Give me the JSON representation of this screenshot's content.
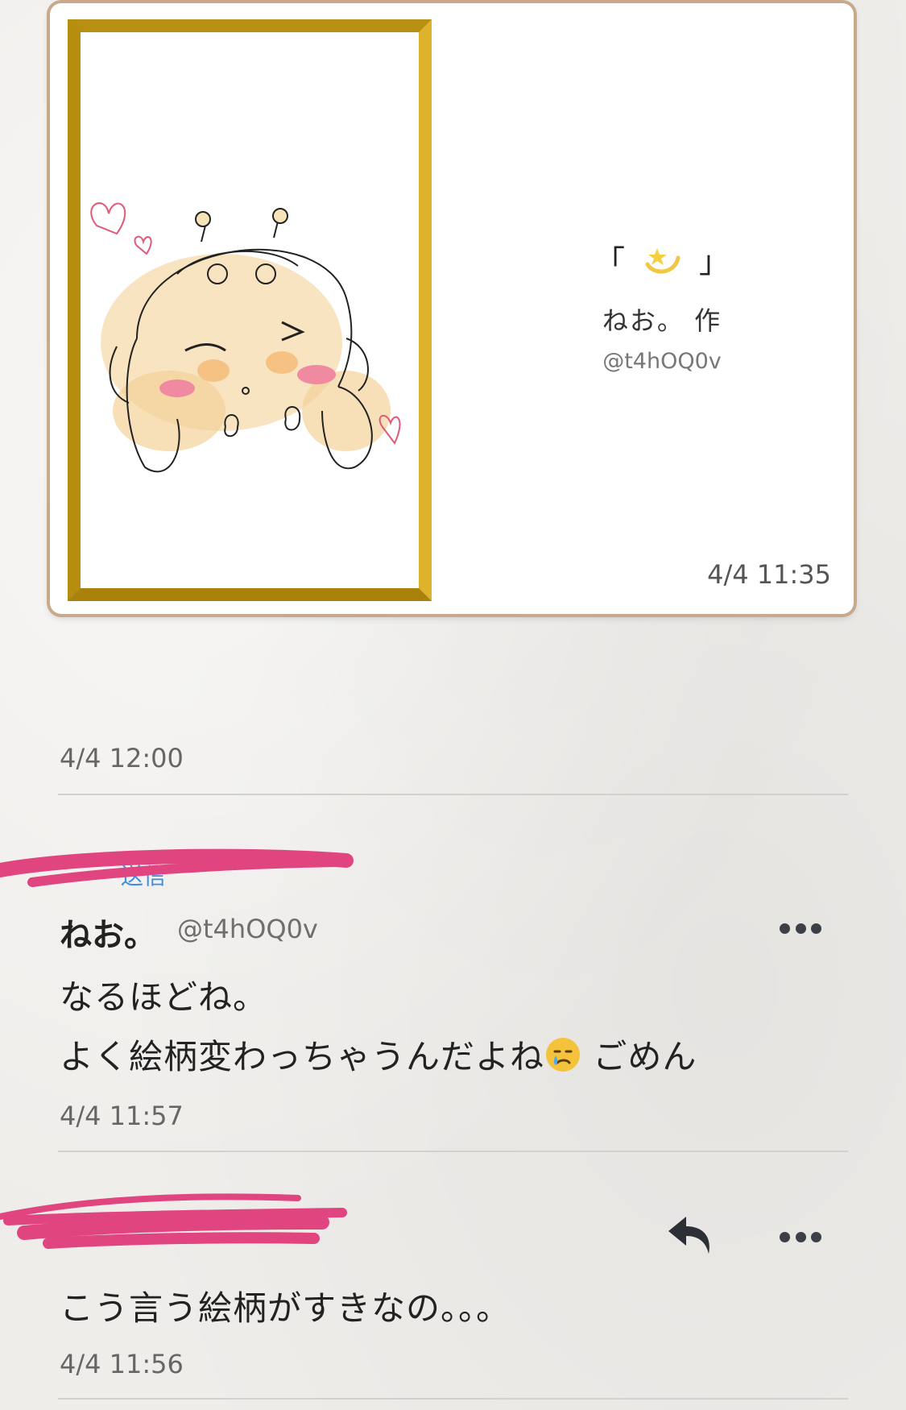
{
  "artwork_card": {
    "title_open": "「",
    "title_close": "」",
    "title_emoji_icon": "dizzy-star-icon",
    "author": "ねお。 作",
    "author_handle": "@t4hOQ0v",
    "timestamp": "4/4 11:35"
  },
  "post_time": "4/4 12:00",
  "messages": [
    {
      "reply_to": "送信",
      "name": "ねお。",
      "handle": "@t4hOQ0v",
      "line1": "なるほどね。",
      "line2a": "よく絵柄変わっちゃうんだよね",
      "line2_emoji_icon": "crying-face-icon",
      "line2b": " ごめん",
      "timestamp": "4/4 11:57"
    },
    {
      "text": "こう言う絵柄がすきなの。。。",
      "timestamp": "4/4 11:56"
    }
  ],
  "colors": {
    "background": "#efedea",
    "frame_gold": "#c9a21c",
    "card_border": "#c9a98c",
    "redaction_pink": "#e0457f",
    "link_blue": "#3b8de3"
  }
}
